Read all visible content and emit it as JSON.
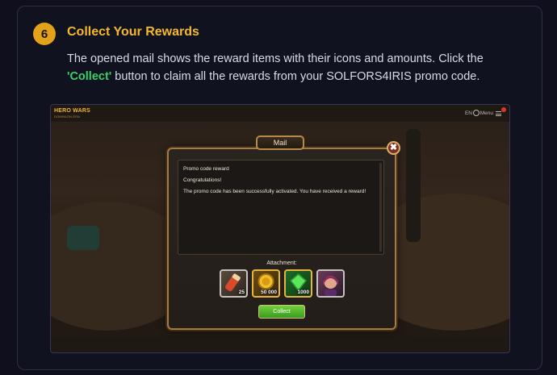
{
  "step": {
    "number": "6",
    "title": "Collect Your Rewards",
    "description_pre": "The opened mail shows the reward items with their icons and amounts. Click the ",
    "description_highlight": "'Collect'",
    "description_post": " button to claim all the rewards from your SOLFORS4IRIS promo code."
  },
  "game": {
    "logo_line1": "HERO WARS",
    "logo_line2": "DOMINION ERA",
    "lang": "EN",
    "menu_label": "Menu",
    "mail": {
      "tab_title": "Mail",
      "close_symbol": "✖",
      "subject": "Promo code reward",
      "greeting": "Congratulations!",
      "body": "The promo code has been successfully activated. You have received a reward!",
      "attachment_label": "Attachment:",
      "attachments": [
        {
          "icon": "scroll-potion-icon",
          "qty": "25"
        },
        {
          "icon": "gold-coin-icon",
          "qty": "50 000"
        },
        {
          "icon": "emerald-icon",
          "qty": "1000"
        },
        {
          "icon": "hero-portrait-icon",
          "qty": ""
        }
      ],
      "collect_label": "Collect"
    }
  },
  "colors": {
    "accent_gold": "#f5b82a",
    "highlight_green": "#34d36a",
    "badge": "#e3a21a"
  }
}
